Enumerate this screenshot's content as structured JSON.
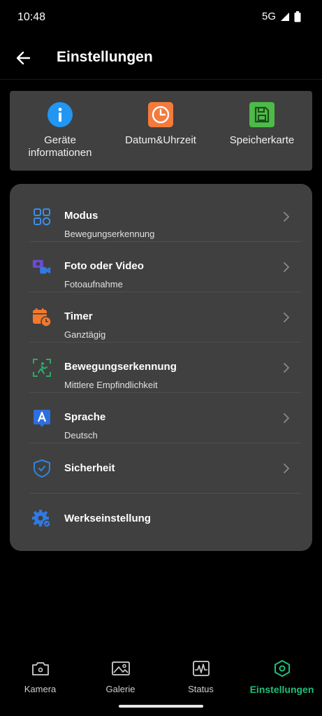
{
  "status": {
    "time": "10:48",
    "network": "5G"
  },
  "header": {
    "title": "Einstellungen"
  },
  "quick": [
    {
      "label": "Geräte\ninformationen",
      "icon": "info-icon",
      "color": "#2196f3"
    },
    {
      "label": "Datum&Uhrzeit",
      "icon": "clock-icon",
      "color": "#f47b3c"
    },
    {
      "label": "Speicherkarte",
      "icon": "sd-card-icon",
      "color": "#4cbb47"
    }
  ],
  "settings": [
    {
      "title": "Modus",
      "subtitle": "Bewegungserkennung",
      "icon": "grid-icon"
    },
    {
      "title": "Foto oder Video",
      "subtitle": "Fotoaufnahme",
      "icon": "camera-video-icon"
    },
    {
      "title": "Timer",
      "subtitle": "Ganztägig",
      "icon": "calendar-clock-icon"
    },
    {
      "title": "Bewegungserkennung",
      "subtitle": "Mittlere Empfindlichkeit",
      "icon": "motion-detect-icon"
    },
    {
      "title": "Sprache",
      "subtitle": "Deutsch",
      "icon": "language-icon"
    },
    {
      "title": "Sicherheit",
      "subtitle": "",
      "icon": "shield-icon"
    },
    {
      "title": "Werkseinstellung",
      "subtitle": "",
      "icon": "gear-icon"
    }
  ],
  "nav": [
    {
      "label": "Kamera",
      "icon": "camera-icon"
    },
    {
      "label": "Galerie",
      "icon": "gallery-icon"
    },
    {
      "label": "Status",
      "icon": "activity-icon"
    },
    {
      "label": "Einstellungen",
      "icon": "hexagon-settings-icon",
      "active": true
    }
  ],
  "colors": {
    "accent": "#1fbf7a",
    "card": "#404040",
    "background": "#000000"
  }
}
